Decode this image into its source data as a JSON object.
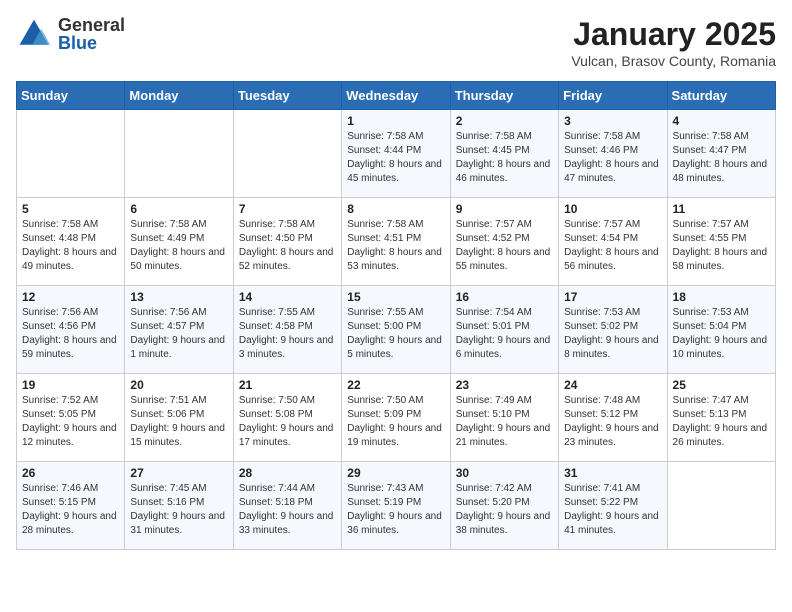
{
  "header": {
    "logo": {
      "general": "General",
      "blue": "Blue"
    },
    "title": "January 2025",
    "subtitle": "Vulcan, Brasov County, Romania"
  },
  "weekdays": [
    "Sunday",
    "Monday",
    "Tuesday",
    "Wednesday",
    "Thursday",
    "Friday",
    "Saturday"
  ],
  "weeks": [
    [
      {
        "day": "",
        "sunrise": "",
        "sunset": "",
        "daylight": ""
      },
      {
        "day": "",
        "sunrise": "",
        "sunset": "",
        "daylight": ""
      },
      {
        "day": "",
        "sunrise": "",
        "sunset": "",
        "daylight": ""
      },
      {
        "day": "1",
        "sunrise": "Sunrise: 7:58 AM",
        "sunset": "Sunset: 4:44 PM",
        "daylight": "Daylight: 8 hours and 45 minutes."
      },
      {
        "day": "2",
        "sunrise": "Sunrise: 7:58 AM",
        "sunset": "Sunset: 4:45 PM",
        "daylight": "Daylight: 8 hours and 46 minutes."
      },
      {
        "day": "3",
        "sunrise": "Sunrise: 7:58 AM",
        "sunset": "Sunset: 4:46 PM",
        "daylight": "Daylight: 8 hours and 47 minutes."
      },
      {
        "day": "4",
        "sunrise": "Sunrise: 7:58 AM",
        "sunset": "Sunset: 4:47 PM",
        "daylight": "Daylight: 8 hours and 48 minutes."
      }
    ],
    [
      {
        "day": "5",
        "sunrise": "Sunrise: 7:58 AM",
        "sunset": "Sunset: 4:48 PM",
        "daylight": "Daylight: 8 hours and 49 minutes."
      },
      {
        "day": "6",
        "sunrise": "Sunrise: 7:58 AM",
        "sunset": "Sunset: 4:49 PM",
        "daylight": "Daylight: 8 hours and 50 minutes."
      },
      {
        "day": "7",
        "sunrise": "Sunrise: 7:58 AM",
        "sunset": "Sunset: 4:50 PM",
        "daylight": "Daylight: 8 hours and 52 minutes."
      },
      {
        "day": "8",
        "sunrise": "Sunrise: 7:58 AM",
        "sunset": "Sunset: 4:51 PM",
        "daylight": "Daylight: 8 hours and 53 minutes."
      },
      {
        "day": "9",
        "sunrise": "Sunrise: 7:57 AM",
        "sunset": "Sunset: 4:52 PM",
        "daylight": "Daylight: 8 hours and 55 minutes."
      },
      {
        "day": "10",
        "sunrise": "Sunrise: 7:57 AM",
        "sunset": "Sunset: 4:54 PM",
        "daylight": "Daylight: 8 hours and 56 minutes."
      },
      {
        "day": "11",
        "sunrise": "Sunrise: 7:57 AM",
        "sunset": "Sunset: 4:55 PM",
        "daylight": "Daylight: 8 hours and 58 minutes."
      }
    ],
    [
      {
        "day": "12",
        "sunrise": "Sunrise: 7:56 AM",
        "sunset": "Sunset: 4:56 PM",
        "daylight": "Daylight: 8 hours and 59 minutes."
      },
      {
        "day": "13",
        "sunrise": "Sunrise: 7:56 AM",
        "sunset": "Sunset: 4:57 PM",
        "daylight": "Daylight: 9 hours and 1 minute."
      },
      {
        "day": "14",
        "sunrise": "Sunrise: 7:55 AM",
        "sunset": "Sunset: 4:58 PM",
        "daylight": "Daylight: 9 hours and 3 minutes."
      },
      {
        "day": "15",
        "sunrise": "Sunrise: 7:55 AM",
        "sunset": "Sunset: 5:00 PM",
        "daylight": "Daylight: 9 hours and 5 minutes."
      },
      {
        "day": "16",
        "sunrise": "Sunrise: 7:54 AM",
        "sunset": "Sunset: 5:01 PM",
        "daylight": "Daylight: 9 hours and 6 minutes."
      },
      {
        "day": "17",
        "sunrise": "Sunrise: 7:53 AM",
        "sunset": "Sunset: 5:02 PM",
        "daylight": "Daylight: 9 hours and 8 minutes."
      },
      {
        "day": "18",
        "sunrise": "Sunrise: 7:53 AM",
        "sunset": "Sunset: 5:04 PM",
        "daylight": "Daylight: 9 hours and 10 minutes."
      }
    ],
    [
      {
        "day": "19",
        "sunrise": "Sunrise: 7:52 AM",
        "sunset": "Sunset: 5:05 PM",
        "daylight": "Daylight: 9 hours and 12 minutes."
      },
      {
        "day": "20",
        "sunrise": "Sunrise: 7:51 AM",
        "sunset": "Sunset: 5:06 PM",
        "daylight": "Daylight: 9 hours and 15 minutes."
      },
      {
        "day": "21",
        "sunrise": "Sunrise: 7:50 AM",
        "sunset": "Sunset: 5:08 PM",
        "daylight": "Daylight: 9 hours and 17 minutes."
      },
      {
        "day": "22",
        "sunrise": "Sunrise: 7:50 AM",
        "sunset": "Sunset: 5:09 PM",
        "daylight": "Daylight: 9 hours and 19 minutes."
      },
      {
        "day": "23",
        "sunrise": "Sunrise: 7:49 AM",
        "sunset": "Sunset: 5:10 PM",
        "daylight": "Daylight: 9 hours and 21 minutes."
      },
      {
        "day": "24",
        "sunrise": "Sunrise: 7:48 AM",
        "sunset": "Sunset: 5:12 PM",
        "daylight": "Daylight: 9 hours and 23 minutes."
      },
      {
        "day": "25",
        "sunrise": "Sunrise: 7:47 AM",
        "sunset": "Sunset: 5:13 PM",
        "daylight": "Daylight: 9 hours and 26 minutes."
      }
    ],
    [
      {
        "day": "26",
        "sunrise": "Sunrise: 7:46 AM",
        "sunset": "Sunset: 5:15 PM",
        "daylight": "Daylight: 9 hours and 28 minutes."
      },
      {
        "day": "27",
        "sunrise": "Sunrise: 7:45 AM",
        "sunset": "Sunset: 5:16 PM",
        "daylight": "Daylight: 9 hours and 31 minutes."
      },
      {
        "day": "28",
        "sunrise": "Sunrise: 7:44 AM",
        "sunset": "Sunset: 5:18 PM",
        "daylight": "Daylight: 9 hours and 33 minutes."
      },
      {
        "day": "29",
        "sunrise": "Sunrise: 7:43 AM",
        "sunset": "Sunset: 5:19 PM",
        "daylight": "Daylight: 9 hours and 36 minutes."
      },
      {
        "day": "30",
        "sunrise": "Sunrise: 7:42 AM",
        "sunset": "Sunset: 5:20 PM",
        "daylight": "Daylight: 9 hours and 38 minutes."
      },
      {
        "day": "31",
        "sunrise": "Sunrise: 7:41 AM",
        "sunset": "Sunset: 5:22 PM",
        "daylight": "Daylight: 9 hours and 41 minutes."
      },
      {
        "day": "",
        "sunrise": "",
        "sunset": "",
        "daylight": ""
      }
    ]
  ]
}
